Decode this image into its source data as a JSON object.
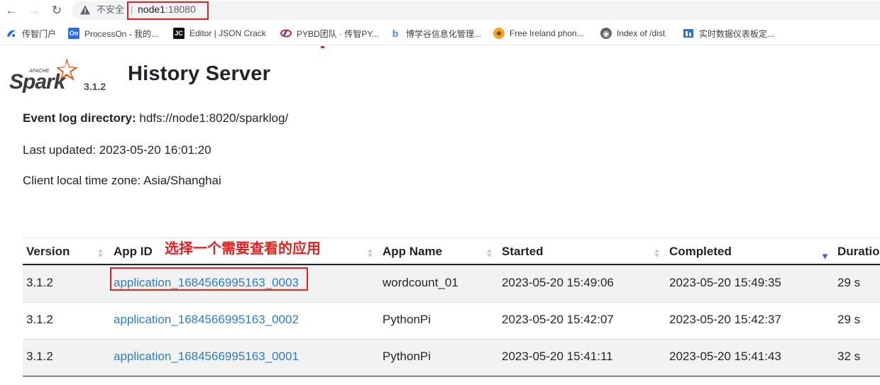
{
  "browser": {
    "security_text": "不安全",
    "url_host": "node1",
    "url_port": ":18080"
  },
  "bookmarks": [
    {
      "label": "传智门户",
      "icon": "chuanzhi-icon"
    },
    {
      "label": "ProcessOn - 我的...",
      "icon": "processon-icon"
    },
    {
      "label": "Editor | JSON Crack",
      "icon": "jsoncrack-icon"
    },
    {
      "label": "PYBD团队 · 传智PY...",
      "icon": "pybd-icon"
    },
    {
      "label": "博学谷信息化管理...",
      "icon": "boxuegu-icon"
    },
    {
      "label": "Free Ireland phon...",
      "icon": "smiley-icon"
    },
    {
      "label": "Index of /dist",
      "icon": "globe-icon"
    },
    {
      "label": "实时数据仪表板定...",
      "icon": "dashboard-icon"
    }
  ],
  "header": {
    "logo_text": "Spark",
    "logo_apache": "APACHE",
    "version": "3.1.2",
    "title": "History Server"
  },
  "info": {
    "event_log_label": "Event log directory:",
    "event_log_value": "hdfs://node1:8020/sparklog/",
    "last_updated": "Last updated: 2023-05-20 16:01:20",
    "timezone": "Client local time zone: Asia/Shanghai"
  },
  "annotation": "选择一个需要查看的应用",
  "table": {
    "columns": [
      "Version",
      "App ID",
      "App Name",
      "Started",
      "Completed",
      "Duratio"
    ],
    "rows": [
      {
        "version": "3.1.2",
        "app_id": "application_1684566995163_0003",
        "app_name": "wordcount_01",
        "started": "2023-05-20 15:49:06",
        "completed": "2023-05-20 15:49:35",
        "duration": "29 s"
      },
      {
        "version": "3.1.2",
        "app_id": "application_1684566995163_0002",
        "app_name": "PythonPi",
        "started": "2023-05-20 15:42:07",
        "completed": "2023-05-20 15:42:37",
        "duration": "29 s"
      },
      {
        "version": "3.1.2",
        "app_id": "application_1684566995163_0001",
        "app_name": "PythonPi",
        "started": "2023-05-20 15:41:11",
        "completed": "2023-05-20 15:41:43",
        "duration": "32 s"
      }
    ]
  },
  "colors": {
    "link": "#2a7ec0",
    "annotation": "#e02020",
    "spark_orange": "#e25a1c"
  }
}
